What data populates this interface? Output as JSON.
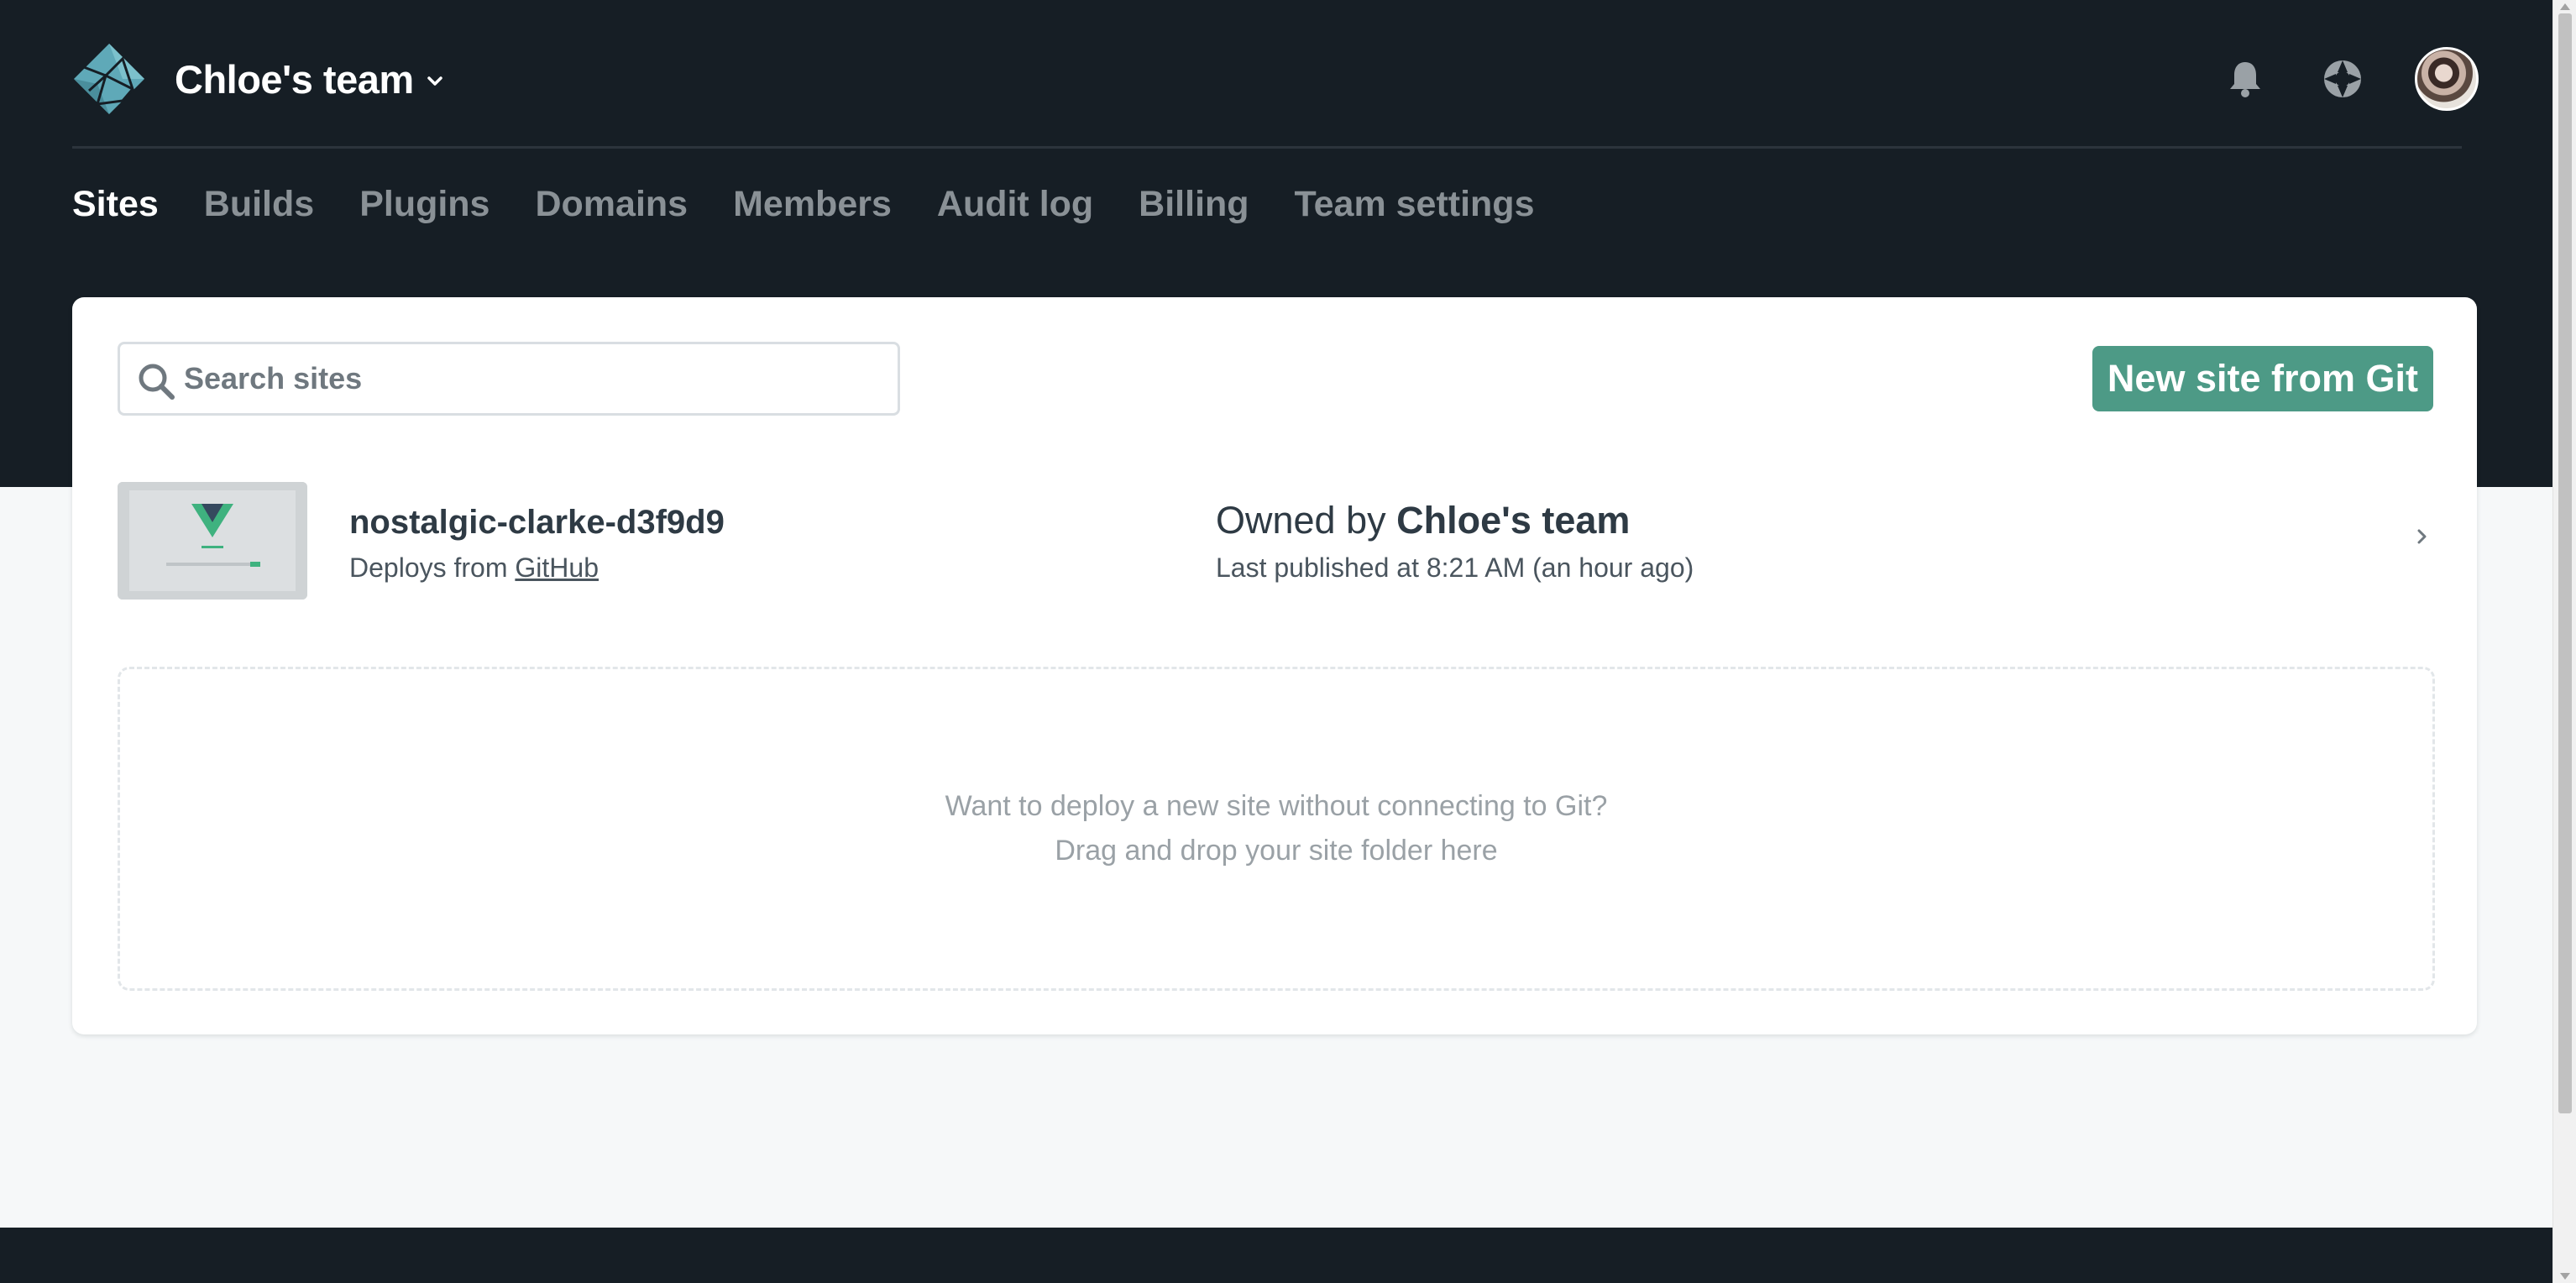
{
  "header": {
    "team_name": "Chloe's team",
    "icons": [
      "netlify-logo-icon",
      "chevron-down-icon",
      "bell-icon",
      "support-lifebuoy-icon",
      "user-avatar"
    ]
  },
  "tabs": [
    {
      "label": "Sites",
      "active": true
    },
    {
      "label": "Builds",
      "active": false
    },
    {
      "label": "Plugins",
      "active": false
    },
    {
      "label": "Domains",
      "active": false
    },
    {
      "label": "Members",
      "active": false
    },
    {
      "label": "Audit log",
      "active": false
    },
    {
      "label": "Billing",
      "active": false
    },
    {
      "label": "Team settings",
      "active": false
    }
  ],
  "search": {
    "placeholder": "Search sites",
    "value": ""
  },
  "new_site_button": "New site from Git",
  "sites": [
    {
      "name": "nostalgic-clarke-d3f9d9",
      "deploys_prefix": "Deploys from",
      "deploys_source": "GitHub",
      "owner_prefix": "Owned by",
      "owner": "Chloe's team",
      "published": "Last published at 8:21 AM (an hour ago)"
    }
  ],
  "dropzone": {
    "line1": "Want to deploy a new site without connecting to Git?",
    "line2": "Drag and drop your site folder here"
  },
  "colors": {
    "header_bg": "#161e25",
    "primary_button": "#4d9a86",
    "logo_teal": "#5fa9b8",
    "page_bg": "#f6f8f9"
  }
}
